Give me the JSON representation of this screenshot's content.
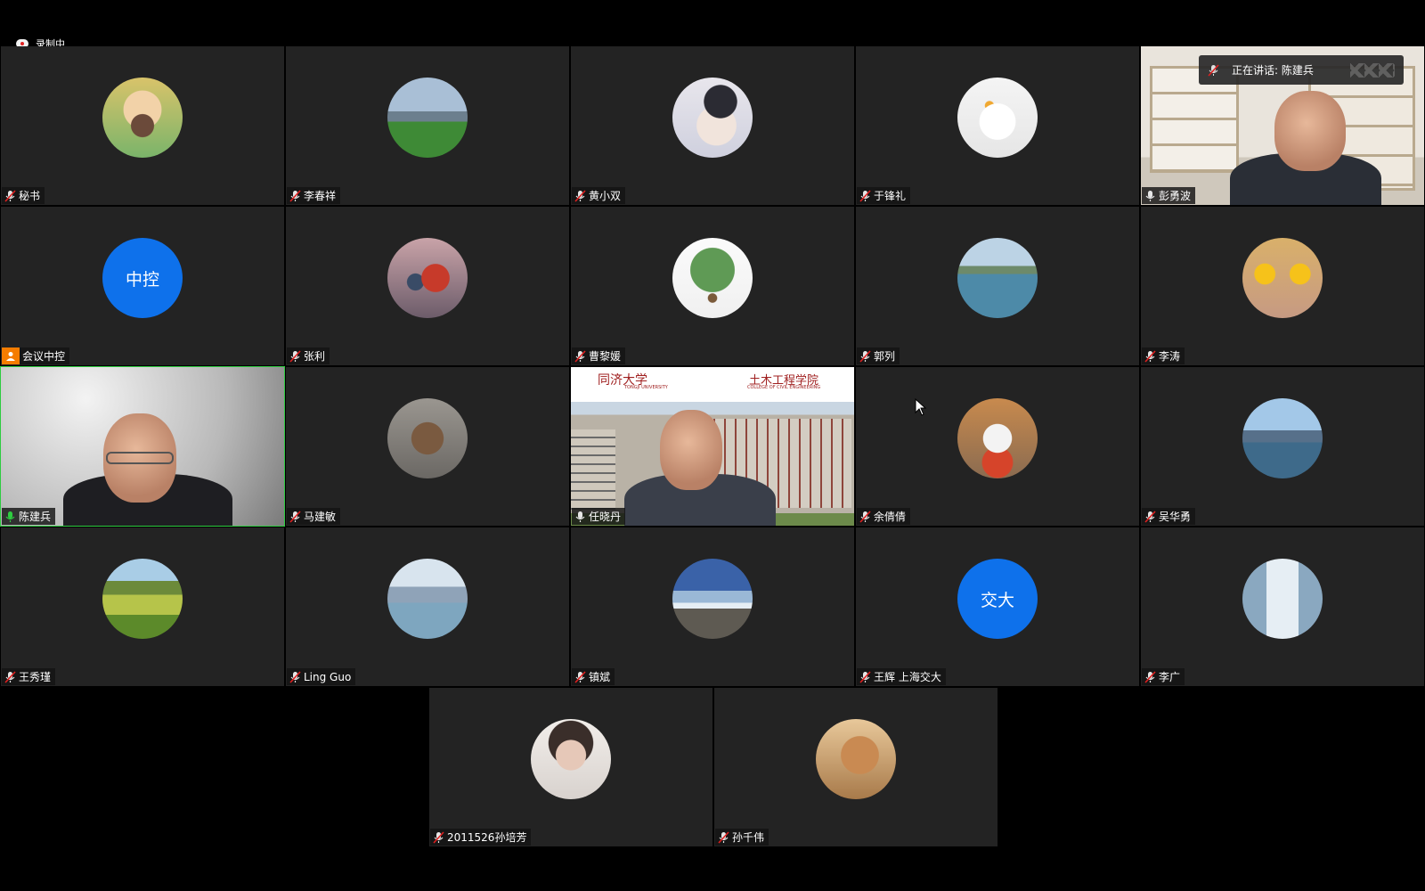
{
  "recording": {
    "label": "录制中"
  },
  "active_speaker": {
    "label": "正在讲话: 陈建兵"
  },
  "colors": {
    "tile_bg": "#232323",
    "avatar_blue": "#0e71eb",
    "host_orange": "#f57c00",
    "mic_green": "#2ecc40",
    "mic_muted_red": "#e02020"
  },
  "participants": [
    {
      "name": "秘书",
      "kind": "photo",
      "avatar": "cartoon-mascot",
      "mic": "muted"
    },
    {
      "name": "李春祥",
      "kind": "photo",
      "avatar": "soccer-field",
      "mic": "muted"
    },
    {
      "name": "黄小双",
      "kind": "photo",
      "avatar": "ink-portrait",
      "mic": "muted"
    },
    {
      "name": "于锋礼",
      "kind": "photo",
      "avatar": "seagull",
      "mic": "muted"
    },
    {
      "name": "彭勇波",
      "kind": "video",
      "avatar": "bookshelf-room",
      "mic": "unmuted-white"
    },
    {
      "name": "会议中控",
      "kind": "text",
      "avatar_text": "中控",
      "mic": "host"
    },
    {
      "name": "张利",
      "kind": "photo",
      "avatar": "mascot-statue",
      "mic": "muted"
    },
    {
      "name": "曹黎媛",
      "kind": "photo",
      "avatar": "tree",
      "mic": "muted"
    },
    {
      "name": "郭列",
      "kind": "photo",
      "avatar": "seaside",
      "mic": "muted"
    },
    {
      "name": "李涛",
      "kind": "photo",
      "avatar": "sunflowers",
      "mic": "muted"
    },
    {
      "name": "陈建兵",
      "kind": "video",
      "avatar": "office-wall",
      "mic": "active-green"
    },
    {
      "name": "马建敏",
      "kind": "photo",
      "avatar": "horse-sculpture",
      "mic": "muted"
    },
    {
      "name": "任晓丹",
      "kind": "video",
      "avatar": "tongji-building",
      "mic": "unmuted-white"
    },
    {
      "name": "余倩倩",
      "kind": "photo",
      "avatar": "toy-figure",
      "mic": "muted"
    },
    {
      "name": "吴华勇",
      "kind": "photo",
      "avatar": "lake",
      "mic": "muted"
    },
    {
      "name": "王秀瑾",
      "kind": "photo",
      "avatar": "countryside",
      "mic": "muted"
    },
    {
      "name": "Ling Guo",
      "kind": "photo",
      "avatar": "mountain-lake",
      "mic": "muted"
    },
    {
      "name": "镇斌",
      "kind": "photo",
      "avatar": "beach",
      "mic": "muted"
    },
    {
      "name": "王辉 上海交大",
      "kind": "text",
      "avatar_text": "交大",
      "mic": "muted"
    },
    {
      "name": "李广",
      "kind": "photo",
      "avatar": "glass-building",
      "mic": "muted"
    },
    {
      "name": "2011526孙培芳",
      "kind": "photo",
      "avatar": "woman-portrait",
      "mic": "muted"
    },
    {
      "name": "孙千伟",
      "kind": "photo",
      "avatar": "thinker-portrait",
      "mic": "muted"
    }
  ],
  "tongji_banner": {
    "left": "同济大学",
    "left_sub": "TONGJI UNIVERSITY",
    "right": "土木工程学院",
    "right_sub": "COLLEGE OF CIVIL ENGINEERING"
  }
}
